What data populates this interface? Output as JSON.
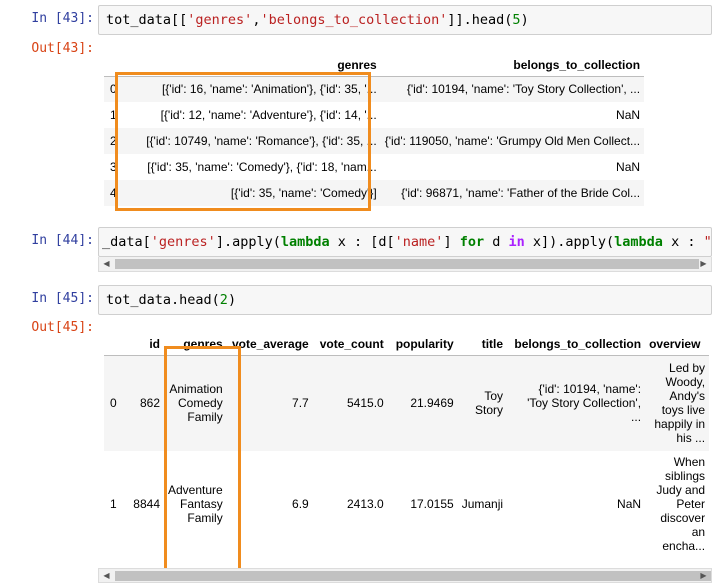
{
  "cells": [
    {
      "in_prompt": "In [43]:",
      "out_prompt": "Out[43]:",
      "code": "tot_data[['genres','belongs_to_collection']].head(5)",
      "table": {
        "columns": [
          "genres",
          "belongs_to_collection"
        ],
        "rows": [
          {
            "index": "0",
            "genres": "[{'id': 16, 'name': 'Animation'}, {'id': 35, '...",
            "belongs_to_collection": "{'id': 10194, 'name': 'Toy Story Collection', ..."
          },
          {
            "index": "1",
            "genres": "[{'id': 12, 'name': 'Adventure'}, {'id': 14, '...",
            "belongs_to_collection": "NaN"
          },
          {
            "index": "2",
            "genres": "[{'id': 10749, 'name': 'Romance'}, {'id': 35, ...",
            "belongs_to_collection": "{'id': 119050, 'name': 'Grumpy Old Men Collect..."
          },
          {
            "index": "3",
            "genres": "[{'id': 35, 'name': 'Comedy'}, {'id': 18, 'nam...",
            "belongs_to_collection": "NaN"
          },
          {
            "index": "4",
            "genres": "[{'id': 35, 'name': 'Comedy'}]",
            "belongs_to_collection": "{'id': 96871, 'name': 'Father of the Bride Col..."
          }
        ]
      }
    },
    {
      "in_prompt": "In [44]:",
      "code": "_data['genres'].apply(lambda x : [d['name'] for d in x]).apply(lambda x : \" \".join(x))"
    },
    {
      "in_prompt": "In [45]:",
      "out_prompt": "Out[45]:",
      "code": "tot_data.head(2)",
      "table": {
        "columns": [
          "id",
          "genres",
          "vote_average",
          "vote_count",
          "popularity",
          "title",
          "belongs_to_collection",
          "overview"
        ],
        "rows": [
          {
            "index": "0",
            "id": "862",
            "genres": [
              "Animation",
              "Comedy",
              "Family"
            ],
            "vote_average": "7.7",
            "vote_count": "5415.0",
            "popularity": "21.9469",
            "title": [
              "Toy",
              "Story"
            ],
            "belongs_to_collection": [
              "{'id': 10194, 'name':",
              "'Toy Story Collection',",
              "..."
            ],
            "overview": [
              "Led by",
              "Woody,",
              "Andy's",
              "toys live",
              "happily in",
              "his ..."
            ]
          },
          {
            "index": "1",
            "id": "8844",
            "genres": [
              "Adventure",
              "Fantasy",
              "Family"
            ],
            "vote_average": "6.9",
            "vote_count": "2413.0",
            "popularity": "17.0155",
            "title": [
              "Jumanji"
            ],
            "belongs_to_collection": [
              "NaN"
            ],
            "overview": [
              "When",
              "siblings",
              "Judy and",
              "Peter",
              "discover",
              "an",
              "encha..."
            ]
          }
        ]
      }
    }
  ],
  "scroll_arrows": {
    "left": "◀",
    "right": "▶"
  },
  "highlight_color": "#f08c1e"
}
